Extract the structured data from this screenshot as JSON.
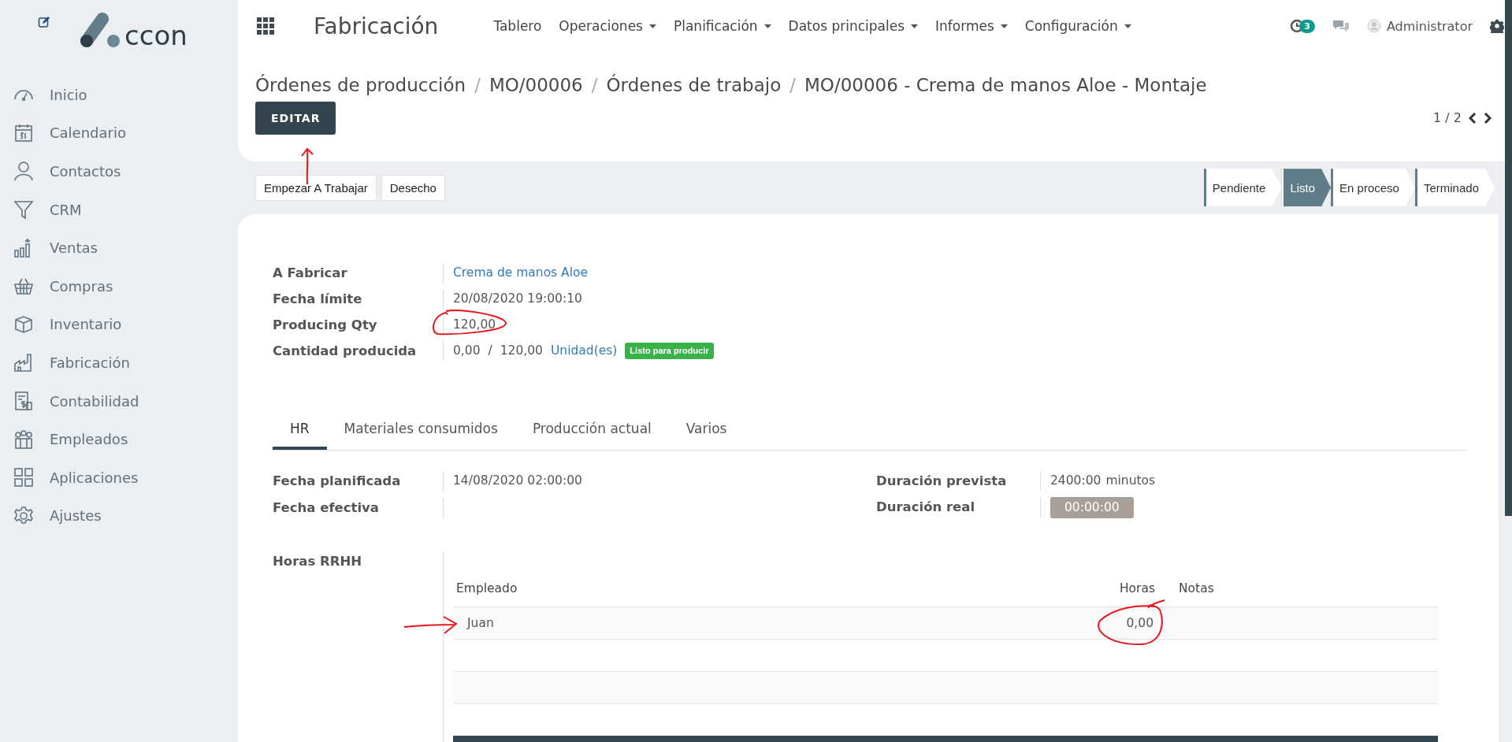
{
  "sidebar": {
    "items": [
      {
        "label": "Inicio"
      },
      {
        "label": "Calendario"
      },
      {
        "label": "Contactos"
      },
      {
        "label": "CRM"
      },
      {
        "label": "Ventas"
      },
      {
        "label": "Compras"
      },
      {
        "label": "Inventario"
      },
      {
        "label": "Fabricación"
      },
      {
        "label": "Contabilidad"
      },
      {
        "label": "Empleados"
      },
      {
        "label": "Aplicaciones"
      },
      {
        "label": "Ajustes"
      }
    ]
  },
  "topbar": {
    "app_title": "Fabricación",
    "menus": [
      {
        "label": "Tablero",
        "dropdown": false
      },
      {
        "label": "Operaciones",
        "dropdown": true
      },
      {
        "label": "Planificación",
        "dropdown": true
      },
      {
        "label": "Datos principales",
        "dropdown": true
      },
      {
        "label": "Informes",
        "dropdown": true
      },
      {
        "label": "Configuración",
        "dropdown": true
      }
    ],
    "activity_count": "3",
    "user": "Administrator"
  },
  "logo_text": "ccon",
  "breadcrumb": {
    "separator": "/",
    "items": [
      "Órdenes de producción",
      "MO/00006",
      "Órdenes de trabajo",
      "MO/00006 - Crema de manos Aloe - Montaje"
    ]
  },
  "edit_button": "EDITAR",
  "pager": "1 / 2",
  "actions": [
    "Empezar A Trabajar",
    "Desecho"
  ],
  "stages": [
    {
      "label": "Pendiente",
      "selected": false
    },
    {
      "label": "Listo",
      "selected": true
    },
    {
      "label": "En proceso",
      "selected": false
    },
    {
      "label": "Terminado",
      "selected": false
    }
  ],
  "fields": [
    {
      "label": "A Fabricar",
      "value": "Crema de manos Aloe",
      "kind": "link"
    },
    {
      "label": "Fecha límite",
      "value": "20/08/2020 19:00:10",
      "kind": "text"
    },
    {
      "label": "Producing Qty",
      "value": "120,00",
      "kind": "text"
    }
  ],
  "produced": {
    "label": "Cantidad producida",
    "done": "0,00",
    "separator": "/",
    "total": "120,00",
    "unit": "Unidad(es)",
    "badge": "Listo para producir"
  },
  "tabs": [
    {
      "label": "HR",
      "selected": true
    },
    {
      "label": "Materiales consumidos",
      "selected": false
    },
    {
      "label": "Producción actual",
      "selected": false
    },
    {
      "label": "Varios",
      "selected": false
    }
  ],
  "hr_left": [
    {
      "label": "Fecha planificada",
      "value": "14/08/2020 02:00:00"
    },
    {
      "label": "Fecha efectiva"
    }
  ],
  "hr_right": [
    {
      "label": "Duración prevista",
      "value": "2400:00",
      "unit": "minutos",
      "kind": "text"
    },
    {
      "label": "Duración real",
      "value": "00:00:00",
      "kind": "timer"
    }
  ],
  "hours": {
    "label": "Horas RRHH",
    "columns": [
      "Empleado",
      "Horas",
      "Notas"
    ],
    "rows": [
      {
        "employee": "Juan",
        "hours": "0,00"
      }
    ]
  }
}
